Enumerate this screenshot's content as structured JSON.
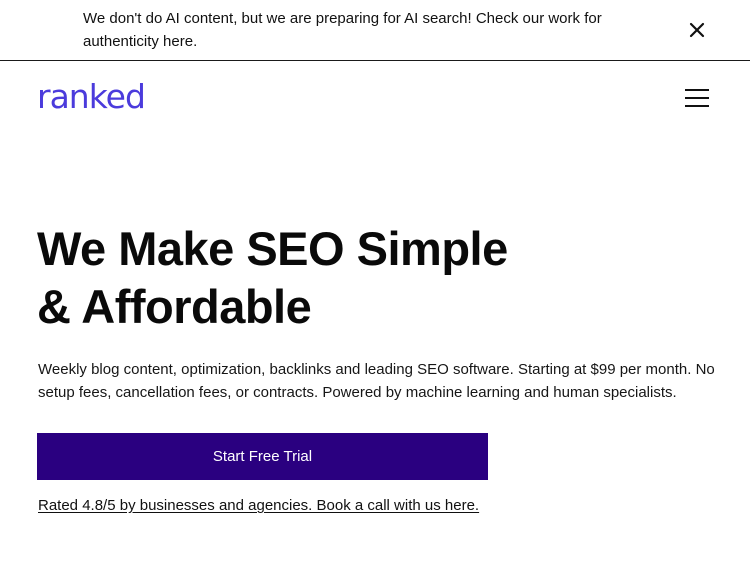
{
  "banner": {
    "text": "We don't do AI content, but we are preparing for AI search! Check our work for authenticity here.",
    "close_icon": "close-icon"
  },
  "nav": {
    "logo_text": "ranked",
    "menu_icon": "hamburger-menu-icon"
  },
  "hero": {
    "title_line1": "We Make SEO Simple",
    "title_line2": "& Affordable",
    "subtitle": "Weekly blog content, optimization, backlinks and leading SEO software. Starting at $99 per month. No setup fees, cancellation fees, or contracts. Powered by machine learning and human specialists.",
    "cta_label": "Start Free Trial",
    "rating_link": "Rated 4.8/5 by businesses and agencies. Book a call with us here."
  },
  "colors": {
    "brand": "#4b3bdc",
    "cta_background": "#2a0080",
    "text": "#0a0a0a"
  }
}
